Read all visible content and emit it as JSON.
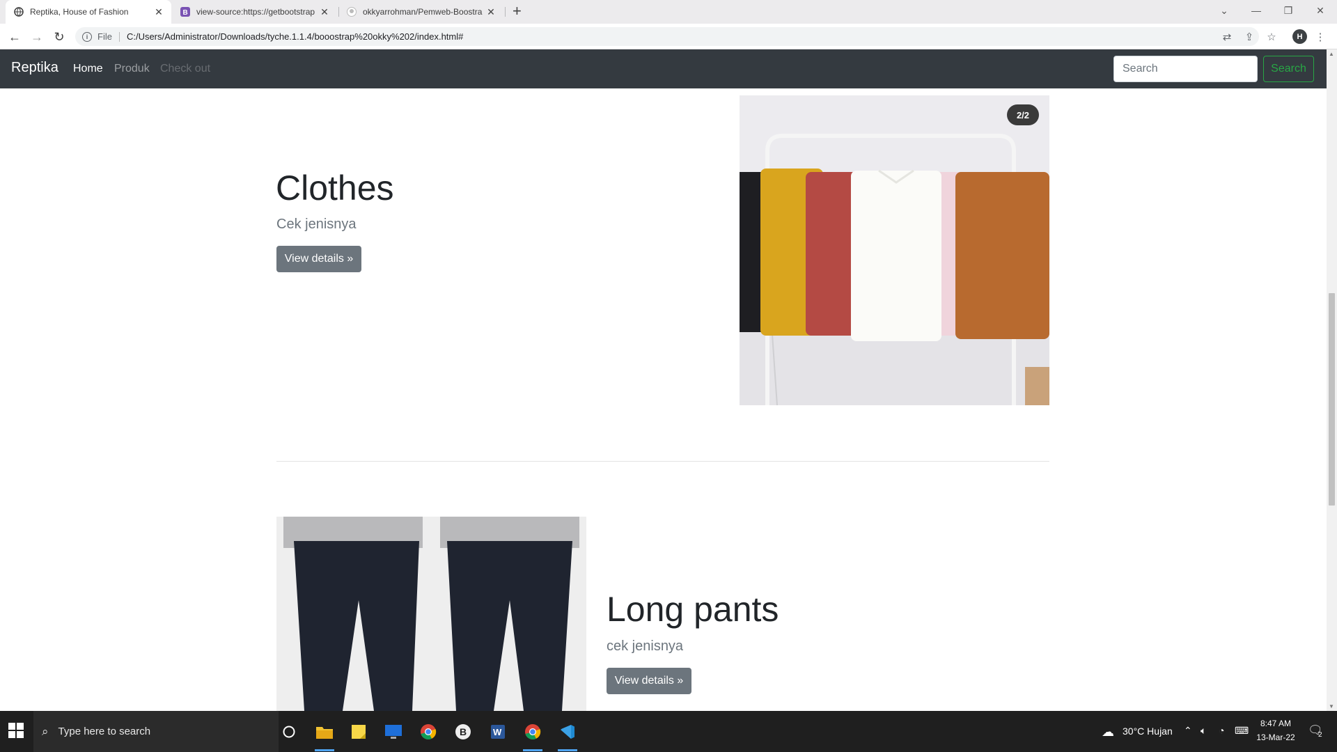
{
  "browser": {
    "tabs": [
      {
        "title": "Reptika, House of Fashion",
        "active": true
      },
      {
        "title": "view-source:https://getbootstrap",
        "active": false
      },
      {
        "title": "okkyarrohman/Pemweb-Boostra",
        "active": false
      }
    ],
    "address": {
      "scheme": "File",
      "url": "C:/Users/Administrator/Downloads/tyche.1.1.4/booostrap%20okky%202/index.html#"
    },
    "profile_initial": "H"
  },
  "site": {
    "brand": "Reptika",
    "nav": [
      {
        "label": "Home",
        "state": "active"
      },
      {
        "label": "Produk",
        "state": "normal"
      },
      {
        "label": "Check out",
        "state": "disabled"
      }
    ],
    "search": {
      "placeholder": "Search",
      "button": "Search"
    }
  },
  "features": [
    {
      "heading": "Clothes",
      "lead": "Cek jenisnya",
      "button": "View details »",
      "image_badge": "2/2"
    },
    {
      "heading": "Long pants",
      "lead": "cek jenisnya",
      "button": "View details »"
    }
  ],
  "taskbar": {
    "search_placeholder": "Type here to search",
    "weather": "30°C  Hujan",
    "time": "8:47 AM",
    "date": "13-Mar-22",
    "notification_count": "2"
  },
  "colors": {
    "navbar": "#343a40",
    "success": "#28a745",
    "secondary": "#6c757d"
  }
}
